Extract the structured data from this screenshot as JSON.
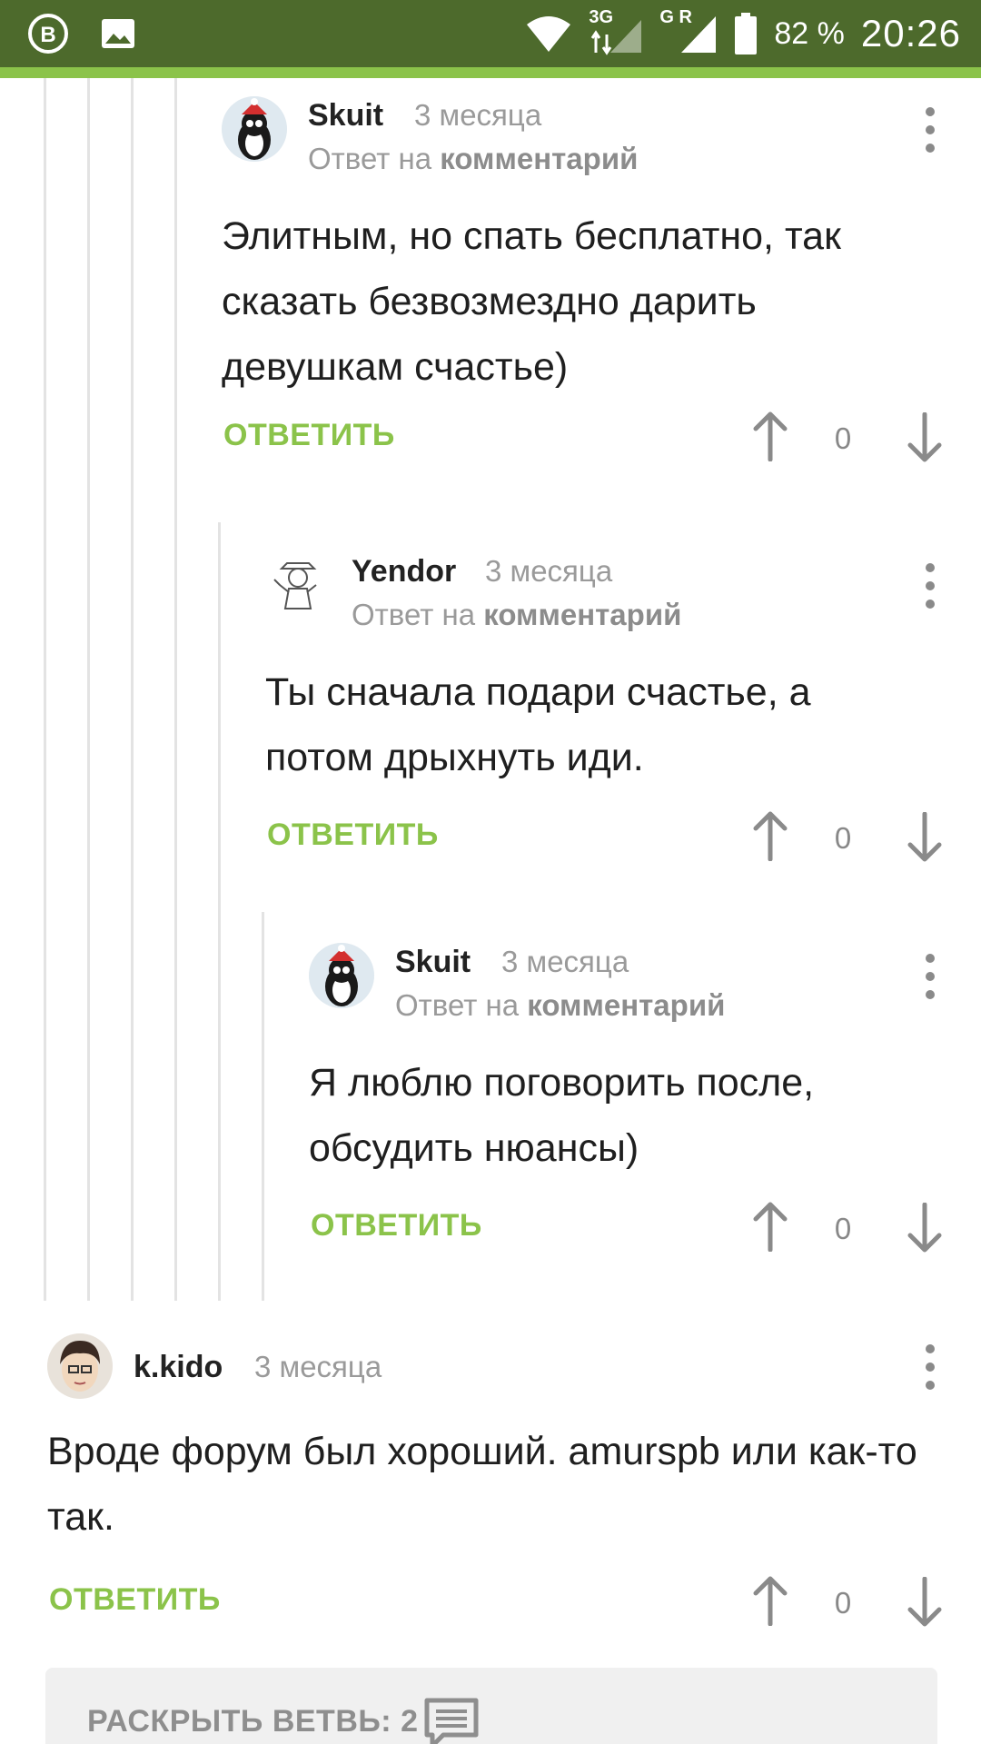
{
  "status_bar": {
    "network_label_1": "3G",
    "network_label_2": "G R",
    "battery": "82 %",
    "time": "20:26"
  },
  "comments": [
    {
      "author": "Skuit",
      "time": "3 месяца",
      "reply_prefix": "Ответ на",
      "reply_link": "комментарий",
      "text": "Элитным, но спать бесплатно, так сказать безвозмездно дарить девушкам счастье)",
      "reply_label": "ОТВЕТИТЬ",
      "score": "0"
    },
    {
      "author": "Yendor",
      "time": "3 месяца",
      "reply_prefix": "Ответ на",
      "reply_link": "комментарий",
      "text": "Ты сначала подари счастье, а потом дрыхнуть иди.",
      "reply_label": "ОТВЕТИТЬ",
      "score": "0"
    },
    {
      "author": "Skuit",
      "time": "3 месяца",
      "reply_prefix": "Ответ на",
      "reply_link": "комментарий",
      "text": "Я люблю поговорить после, обсудить нюансы)",
      "reply_label": "ОТВЕТИТЬ",
      "score": "0"
    },
    {
      "author": "k.kido",
      "time": "3 месяца",
      "text": "Вроде форум был хороший. amurspb или как-то так.",
      "reply_label": "ОТВЕТИТЬ",
      "score": "0"
    }
  ],
  "expand_branch": {
    "label": "РАСКРЫТЬ ВЕТВЬ: 2",
    "icon": "comment-icon"
  },
  "colors": {
    "status_bar": "#4d6a2c",
    "accent": "#8bc34a"
  }
}
